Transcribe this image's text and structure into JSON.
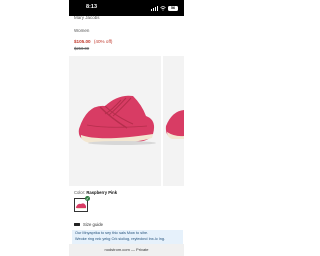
{
  "status_bar": {
    "time": "8:13",
    "battery": "56"
  },
  "product": {
    "brand": "Mary Jacobs",
    "category": "Women",
    "sale_price": "$105.00",
    "discount": "(40% off)",
    "original_price": "$250.00",
    "color_label": "Color:",
    "color_name": "Raspberry Pink"
  },
  "size_guide": {
    "label": "Size guide"
  },
  "info_banner": {
    "line1": "Our Mnyaprika to sey thic sals Mow to sihe.",
    "line2": "Weoke ring nnk yekg Crk sioliog, reylecknd Inx-Ic lng."
  },
  "browser": {
    "url": "nodstrom.com — Private"
  },
  "colors": {
    "shoe": "#d83c64",
    "accent_price": "#c0382b",
    "banner_bg": "#e6f1fb",
    "selected_check": "#2c7a3f"
  }
}
